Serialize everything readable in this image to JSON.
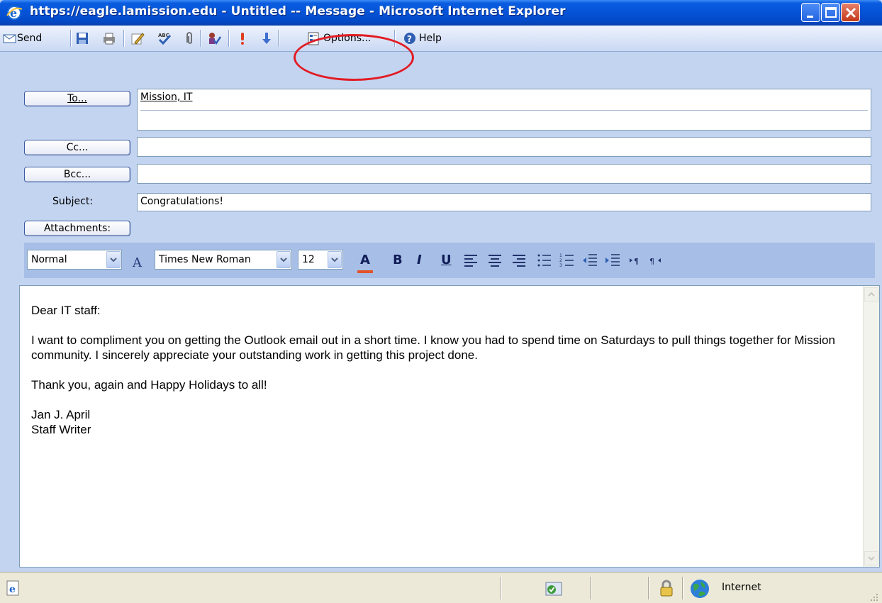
{
  "window": {
    "title": "https://eagle.lamission.edu - Untitled -- Message - Microsoft Internet Explorer"
  },
  "toolbar": {
    "send_label": "Send",
    "options_label": "Options...",
    "help_label": "Help"
  },
  "address": {
    "to_button": "To...",
    "cc_button": "Cc...",
    "bcc_button": "Bcc...",
    "subject_label": "Subject:",
    "attachments_button": "Attachments:",
    "to_value": "Mission, IT",
    "cc_value": "",
    "bcc_value": "",
    "subject_value": "Congratulations!"
  },
  "format": {
    "style": "Normal",
    "font": "Times New Roman",
    "size": "12",
    "font_color_glyph": "A",
    "bold_glyph": "B",
    "italic_glyph": "I",
    "underline_glyph": "U"
  },
  "body": {
    "greeting": "Dear IT staff:",
    "paragraph1": "I want to compliment you on getting the Outlook email out in a short time. I know you had to spend time on Saturdays to pull things together for Mission community. I sincerely appreciate your outstanding work in getting this project done.",
    "paragraph2": "Thank you, again and Happy Holidays to all!",
    "signature_name": "Jan J. April",
    "signature_title": "Staff Writer"
  },
  "status": {
    "zone": "Internet"
  },
  "colors": {
    "title_bar": "#0552d6",
    "annotation": "#e21c24",
    "font_color_underline": "#e2532b"
  }
}
